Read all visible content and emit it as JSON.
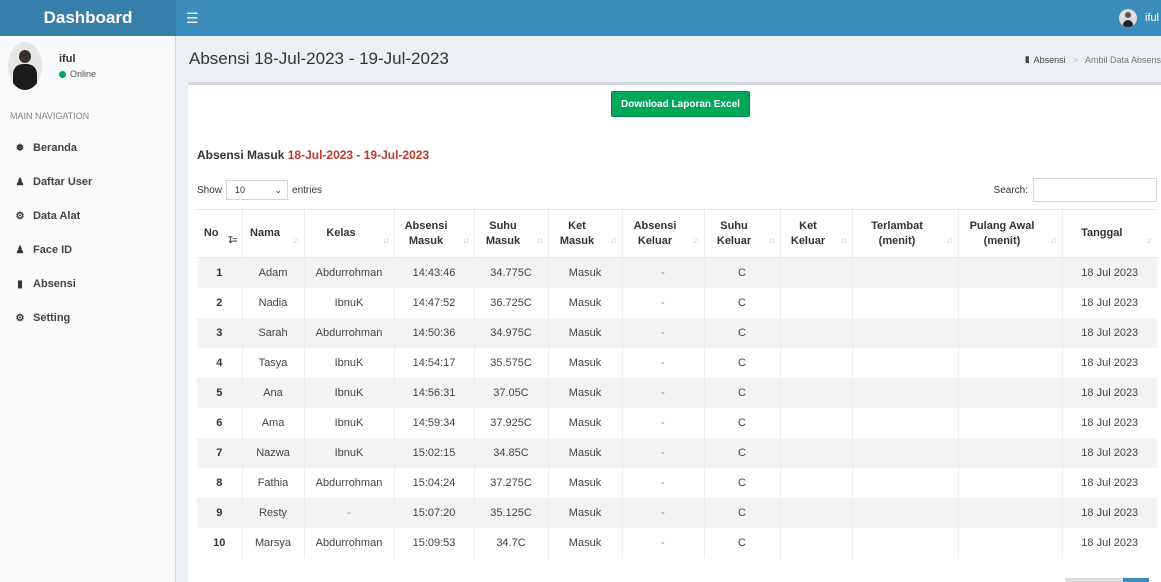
{
  "app": {
    "brand": "Dashboard",
    "menu_icon": "hamburger-icon"
  },
  "topbar": {
    "user_name": "iful"
  },
  "sidebar": {
    "user_name": "iful",
    "status": "Online",
    "nav_header": "MAIN NAVIGATION",
    "items": [
      {
        "label": "Beranda",
        "icon": "dashboard-icon"
      },
      {
        "label": "Daftar User",
        "icon": "users-icon"
      },
      {
        "label": "Data Alat",
        "icon": "cogs-icon"
      },
      {
        "label": "Face ID",
        "icon": "user-icon"
      },
      {
        "label": "Absensi",
        "icon": "book-icon"
      },
      {
        "label": "Setting",
        "icon": "gear-icon"
      }
    ]
  },
  "header": {
    "title": "Absensi 18-Jul-2023 - 19-Jul-2023",
    "breadcrumb": [
      "Absensi",
      "Ambil Data Absens"
    ]
  },
  "actions": {
    "download_label": "Download Laporan Excel"
  },
  "section": {
    "title_prefix": "Absensi Masuk",
    "title_range": "18-Jul-2023 - 19-Jul-2023"
  },
  "controls": {
    "show_label": "Show",
    "entries_value": "10",
    "entries_label": "entries",
    "search_label": "Search:"
  },
  "table": {
    "columns": [
      [
        "No"
      ],
      [
        "Nama"
      ],
      [
        "Kelas"
      ],
      [
        "Absensi",
        "Masuk"
      ],
      [
        "Suhu",
        "Masuk"
      ],
      [
        "Ket",
        "Masuk"
      ],
      [
        "Absensi",
        "Keluar"
      ],
      [
        "Suhu",
        "Keluar"
      ],
      [
        "Ket",
        "Keluar"
      ],
      [
        "Terlambat",
        "(menit)"
      ],
      [
        "Pulang Awal",
        "(menit)"
      ],
      [
        "Tanggal"
      ]
    ],
    "rows": [
      [
        "1",
        "Adam",
        "Abdurrohman",
        "14:43:46",
        "34.775C",
        "Masuk",
        "-",
        "C",
        "",
        "",
        "",
        "18 Jul 2023"
      ],
      [
        "2",
        "Nadia",
        "IbnuK",
        "14:47:52",
        "36.725C",
        "Masuk",
        "-",
        "C",
        "",
        "",
        "",
        "18 Jul 2023"
      ],
      [
        "3",
        "Sarah",
        "Abdurrohman",
        "14:50:36",
        "34.975C",
        "Masuk",
        "-",
        "C",
        "",
        "",
        "",
        "18 Jul 2023"
      ],
      [
        "4",
        "Tasya",
        "IbnuK",
        "14:54:17",
        "35.575C",
        "Masuk",
        "-",
        "C",
        "",
        "",
        "",
        "18 Jul 2023"
      ],
      [
        "5",
        "Ana",
        "IbnuK",
        "14:56:31",
        "37.05C",
        "Masuk",
        "-",
        "C",
        "",
        "",
        "",
        "18 Jul 2023"
      ],
      [
        "6",
        "Ama",
        "IbnuK",
        "14:59:34",
        "37.925C",
        "Masuk",
        "-",
        "C",
        "",
        "",
        "",
        "18 Jul 2023"
      ],
      [
        "7",
        "Nazwa",
        "IbnuK",
        "15:02:15",
        "34.85C",
        "Masuk",
        "-",
        "C",
        "",
        "",
        "",
        "18 Jul 2023"
      ],
      [
        "8",
        "Fathia",
        "Abdurrohman",
        "15:04:24",
        "37.275C",
        "Masuk",
        "-",
        "C",
        "",
        "",
        "",
        "18 Jul 2023"
      ],
      [
        "9",
        "Resty",
        "-",
        "15:07:20",
        "35.125C",
        "Masuk",
        "-",
        "C",
        "",
        "",
        "",
        "18 Jul 2023"
      ],
      [
        "10",
        "Marsya",
        "Abdurrohman",
        "15:09:53",
        "34.7C",
        "Masuk",
        "-",
        "C",
        "",
        "",
        "",
        "18 Jul 2023"
      ]
    ]
  },
  "colors": {
    "topbar": "#3c8dbc",
    "brand_bg": "#367fa9",
    "button": "#00a65a",
    "date_range": "#c0392b"
  }
}
